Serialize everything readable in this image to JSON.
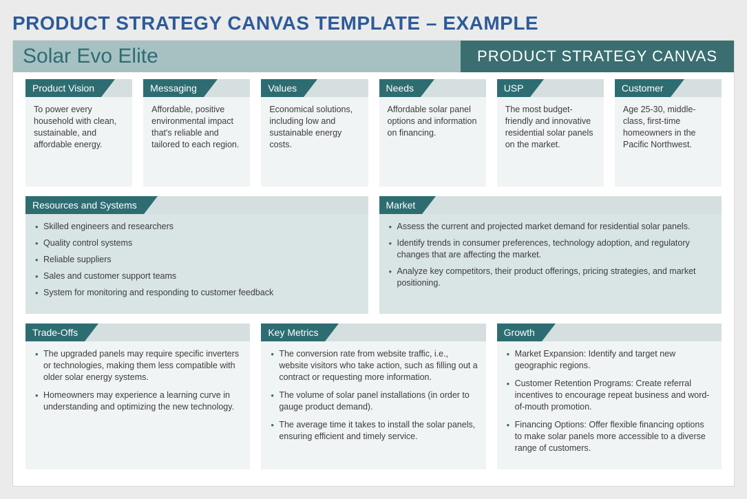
{
  "page_title": "PRODUCT STRATEGY CANVAS TEMPLATE – EXAMPLE",
  "header": {
    "product_name": "Solar Evo Elite",
    "label": "PRODUCT STRATEGY CANVAS"
  },
  "row1": [
    {
      "title": "Product Vision",
      "text": "To power every household with clean, sustainable, and affordable energy."
    },
    {
      "title": "Messaging",
      "text": "Affordable, positive environmental impact that's reliable and tailored to each region."
    },
    {
      "title": "Values",
      "text": "Economical solutions, including low and sustainable energy costs."
    },
    {
      "title": "Needs",
      "text": "Affordable solar panel options and information on financing."
    },
    {
      "title": "USP",
      "text": "The most budget-friendly and innovative residential solar panels on the market."
    },
    {
      "title": "Customer",
      "text": "Age 25-30, middle-class, first-time homeowners in the Pacific Northwest."
    }
  ],
  "row2": [
    {
      "title": "Resources and Systems",
      "bullets": [
        "Skilled engineers and researchers",
        "Quality control systems",
        "Reliable suppliers",
        "Sales and customer support teams",
        "System for monitoring and responding to customer feedback"
      ]
    },
    {
      "title": "Market",
      "bullets": [
        "Assess the current and projected market demand for residential solar panels.",
        "Identify trends in consumer preferences, technology adoption, and regulatory changes that are affecting the market.",
        "Analyze key competitors, their product offerings, pricing strategies, and market positioning."
      ]
    }
  ],
  "row3": [
    {
      "title": "Trade-Offs",
      "bullets": [
        "The upgraded panels may require specific inverters or technologies, making them less compatible with older solar energy systems.",
        "Homeowners may experience a learning curve in understanding and optimizing the new technology."
      ]
    },
    {
      "title": "Key Metrics",
      "bullets": [
        "The conversion rate from website traffic, i.e., website visitors who take action, such as filling out a contract or requesting more information.",
        "The volume of solar panel installations (in order to gauge product demand).",
        "The average time it takes to install the solar panels, ensuring efficient and timely service."
      ]
    },
    {
      "title": "Growth",
      "bullets": [
        "Market Expansion: Identify and target new geographic regions.",
        "Customer Retention Programs: Create referral incentives to encourage repeat business and word-of-mouth promotion.",
        "Financing Options: Offer flexible financing options to make solar panels more accessible to a diverse range of customers."
      ]
    }
  ]
}
